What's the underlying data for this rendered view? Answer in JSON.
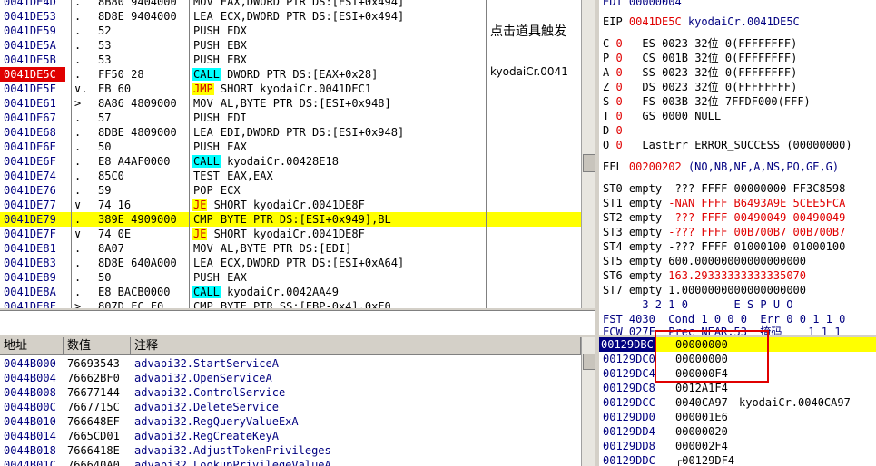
{
  "disasm": {
    "rows": [
      {
        "addr": "0041DE4D",
        "mark": ".",
        "hex": "8B80 9404000",
        "mn": "MOV",
        "ops": " EAX,DWORD PTR DS:[ESI+0x494]",
        "mnclass": "",
        "bp": false,
        "hl": false
      },
      {
        "addr": "0041DE53",
        "mark": ".",
        "hex": "8D8E 9404000",
        "mn": "LEA",
        "ops": " ECX,DWORD PTR DS:[ESI+0x494]",
        "mnclass": "",
        "bp": false,
        "hl": false
      },
      {
        "addr": "0041DE59",
        "mark": ".",
        "hex": "52",
        "mn": "PUSH",
        "ops": " EDX",
        "mnclass": "",
        "bp": false,
        "hl": false
      },
      {
        "addr": "0041DE5A",
        "mark": ".",
        "hex": "53",
        "mn": "PUSH",
        "ops": " EBX",
        "mnclass": "",
        "bp": false,
        "hl": false
      },
      {
        "addr": "0041DE5B",
        "mark": ".",
        "hex": "53",
        "mn": "PUSH",
        "ops": " EBX",
        "mnclass": "",
        "bp": false,
        "hl": false
      },
      {
        "addr": "0041DE5C",
        "mark": ".",
        "hex": "FF50 28",
        "mn": "CALL",
        "ops": " DWORD PTR DS:[EAX+0x28]",
        "mnclass": "mn-call",
        "bp": true,
        "hl": false
      },
      {
        "addr": "0041DE5F",
        "mark": "∨.",
        "hex": "EB 60",
        "mn": "JMP",
        "ops": " SHORT kyodaiCr.0041DEC1",
        "mnclass": "mn-jmp",
        "bp": false,
        "hl": false
      },
      {
        "addr": "0041DE61",
        "mark": ">",
        "hex": "8A86 4809000",
        "mn": "MOV",
        "ops": " AL,BYTE PTR DS:[ESI+0x948]",
        "mnclass": "",
        "bp": false,
        "hl": false
      },
      {
        "addr": "0041DE67",
        "mark": ".",
        "hex": "57",
        "mn": "PUSH",
        "ops": " EDI",
        "mnclass": "",
        "bp": false,
        "hl": false
      },
      {
        "addr": "0041DE68",
        "mark": ".",
        "hex": "8DBE 4809000",
        "mn": "LEA",
        "ops": " EDI,DWORD PTR DS:[ESI+0x948]",
        "mnclass": "",
        "bp": false,
        "hl": false
      },
      {
        "addr": "0041DE6E",
        "mark": ".",
        "hex": "50",
        "mn": "PUSH",
        "ops": " EAX",
        "mnclass": "",
        "bp": false,
        "hl": false
      },
      {
        "addr": "0041DE6F",
        "mark": ".",
        "hex": "E8 A4AF0000",
        "mn": "CALL",
        "ops": " kyodaiCr.00428E18",
        "mnclass": "mn-call",
        "bp": false,
        "hl": false
      },
      {
        "addr": "0041DE74",
        "mark": ".",
        "hex": "85C0",
        "mn": "TEST",
        "ops": " EAX,EAX",
        "mnclass": "",
        "bp": false,
        "hl": false
      },
      {
        "addr": "0041DE76",
        "mark": ".",
        "hex": "59",
        "mn": "POP",
        "ops": " ECX",
        "mnclass": "",
        "bp": false,
        "hl": false
      },
      {
        "addr": "0041DE77",
        "mark": "∨",
        "hex": "74 16",
        "mn": "JE",
        "ops": " SHORT kyodaiCr.0041DE8F",
        "mnclass": "mn-je",
        "bp": false,
        "hl": false
      },
      {
        "addr": "0041DE79",
        "mark": ".",
        "hex": "389E 4909000",
        "mn": "CMP",
        "ops": " BYTE PTR DS:[ESI+0x949],BL",
        "mnclass": "",
        "bp": false,
        "hl": true
      },
      {
        "addr": "0041DE7F",
        "mark": "∨",
        "hex": "74 0E",
        "mn": "JE",
        "ops": " SHORT kyodaiCr.0041DE8F",
        "mnclass": "mn-je",
        "bp": false,
        "hl": false
      },
      {
        "addr": "0041DE81",
        "mark": ".",
        "hex": "8A07",
        "mn": "MOV",
        "ops": " AL,BYTE PTR DS:[EDI]",
        "mnclass": "",
        "bp": false,
        "hl": false
      },
      {
        "addr": "0041DE83",
        "mark": ".",
        "hex": "8D8E 640A000",
        "mn": "LEA",
        "ops": " ECX,DWORD PTR DS:[ESI+0xA64]",
        "mnclass": "",
        "bp": false,
        "hl": false
      },
      {
        "addr": "0041DE89",
        "mark": ".",
        "hex": "50",
        "mn": "PUSH",
        "ops": " EAX",
        "mnclass": "",
        "bp": false,
        "hl": false
      },
      {
        "addr": "0041DE8A",
        "mark": ".",
        "hex": "E8 BACB0000",
        "mn": "CALL",
        "ops": " kyodaiCr.0042AA49",
        "mnclass": "mn-call",
        "bp": false,
        "hl": false
      },
      {
        "addr": "0041DE8F",
        "mark": ">",
        "hex": "807D FC F0",
        "mn": "CMP",
        "ops": " BYTE PTR SS:[EBP-0x4],0xF0",
        "mnclass": "",
        "bp": false,
        "hl": false
      }
    ],
    "comment_trigger": "点击道具触发",
    "comment_call": "kyodaiCr.0041"
  },
  "registers": {
    "edi": "EDI 00000004",
    "eip_label": "EIP",
    "eip_value": "0041DE5C",
    "eip_sym": "kyodaiCr.0041DE5C",
    "flags": [
      {
        "f": "C",
        "v": "0",
        "seg": "ES 0023 32位 0(FFFFFFFF)"
      },
      {
        "f": "P",
        "v": "0",
        "seg": "CS 001B 32位 0(FFFFFFFF)"
      },
      {
        "f": "A",
        "v": "0",
        "seg": "SS 0023 32位 0(FFFFFFFF)"
      },
      {
        "f": "Z",
        "v": "0",
        "seg": "DS 0023 32位 0(FFFFFFFF)"
      },
      {
        "f": "S",
        "v": "0",
        "seg": "FS 003B 32位 7FFDF000(FFF)"
      },
      {
        "f": "T",
        "v": "0",
        "seg": "GS 0000 NULL"
      },
      {
        "f": "D",
        "v": "0",
        "seg": ""
      },
      {
        "f": "O",
        "v": "0",
        "seg": "LastErr ERROR_SUCCESS (00000000)"
      }
    ],
    "efl_label": "EFL",
    "efl_value": "00200202",
    "efl_desc": "(NO,NB,NE,A,NS,PO,GE,G)",
    "fpu": [
      {
        "name": "ST0",
        "state": "empty",
        "val": "-??? FFFF 00000000 FF3C8598",
        "red": false
      },
      {
        "name": "ST1",
        "state": "empty",
        "val": "-NAN FFFF B6493A9E 5CEE5FCA",
        "red": true
      },
      {
        "name": "ST2",
        "state": "empty",
        "val": "-??? FFFF 00490049 00490049",
        "red": true
      },
      {
        "name": "ST3",
        "state": "empty",
        "val": "-??? FFFF 00B700B7 00B700B7",
        "red": true
      },
      {
        "name": "ST4",
        "state": "empty",
        "val": "-??? FFFF 01000100 01000100",
        "red": false
      },
      {
        "name": "ST5",
        "state": "empty",
        "val": "600.00000000000000000",
        "red": false
      },
      {
        "name": "ST6",
        "state": "empty",
        "val": "163.29333333333335070",
        "red": true
      },
      {
        "name": "ST7",
        "state": "empty",
        "val": "1.0000000000000000000",
        "red": false
      }
    ],
    "fpu_bits_header": "      3 2 1 0       E S P U O",
    "fst_line": "FST 4030  Cond 1 0 0 0  Err 0 0 1 1 0",
    "fcw_line": "FCW 027F  Prec NEAR,53  掩码    1 1 1"
  },
  "dump": {
    "headers": [
      "地址",
      "数值",
      "注释"
    ],
    "rows": [
      {
        "addr": "0044B000",
        "val": "76693543",
        "cm": "advapi32.StartServiceA"
      },
      {
        "addr": "0044B004",
        "val": "76662BF0",
        "cm": "advapi32.OpenServiceA"
      },
      {
        "addr": "0044B008",
        "val": "76677144",
        "cm": "advapi32.ControlService"
      },
      {
        "addr": "0044B00C",
        "val": "7667715C",
        "cm": "advapi32.DeleteService"
      },
      {
        "addr": "0044B010",
        "val": "766648EF",
        "cm": "advapi32.RegQueryValueExA"
      },
      {
        "addr": "0044B014",
        "val": "7665CD01",
        "cm": "advapi32.RegCreateKeyA"
      },
      {
        "addr": "0044B018",
        "val": "7666418E",
        "cm": "advapi32.AdjustTokenPrivileges"
      },
      {
        "addr": "0044B01C",
        "val": "766640A0",
        "cm": "advapi32.LookupPrivilegeValueA"
      }
    ]
  },
  "stack": {
    "rows": [
      {
        "addr": "00129DBC",
        "val": "00000000",
        "cm": "",
        "cur": true,
        "hl": true
      },
      {
        "addr": "00129DC0",
        "val": "00000000",
        "cm": "",
        "cur": false,
        "hl": false
      },
      {
        "addr": "00129DC4",
        "val": "000000F4",
        "cm": "",
        "cur": false,
        "hl": false
      },
      {
        "addr": "00129DC8",
        "val": "0012A1F4",
        "cm": "",
        "cur": false,
        "hl": false
      },
      {
        "addr": "00129DCC",
        "val": "0040CA97",
        "cm": "kyodaiCr.0040CA97",
        "cur": false,
        "hl": false
      },
      {
        "addr": "00129DD0",
        "val": "000001E6",
        "cm": "",
        "cur": false,
        "hl": false
      },
      {
        "addr": "00129DD4",
        "val": "00000020",
        "cm": "",
        "cur": false,
        "hl": false
      },
      {
        "addr": "00129DD8",
        "val": "000002F4",
        "cm": "",
        "cur": false,
        "hl": false
      },
      {
        "addr": "00129DDC",
        "val": "┌00129DF4",
        "cm": "",
        "cur": false,
        "hl": false
      }
    ]
  },
  "colors": {
    "highlight": "#ffff00",
    "breakpoint": "#e00000",
    "annotation_box": "#e00000",
    "call_bg": "#00ffff"
  }
}
